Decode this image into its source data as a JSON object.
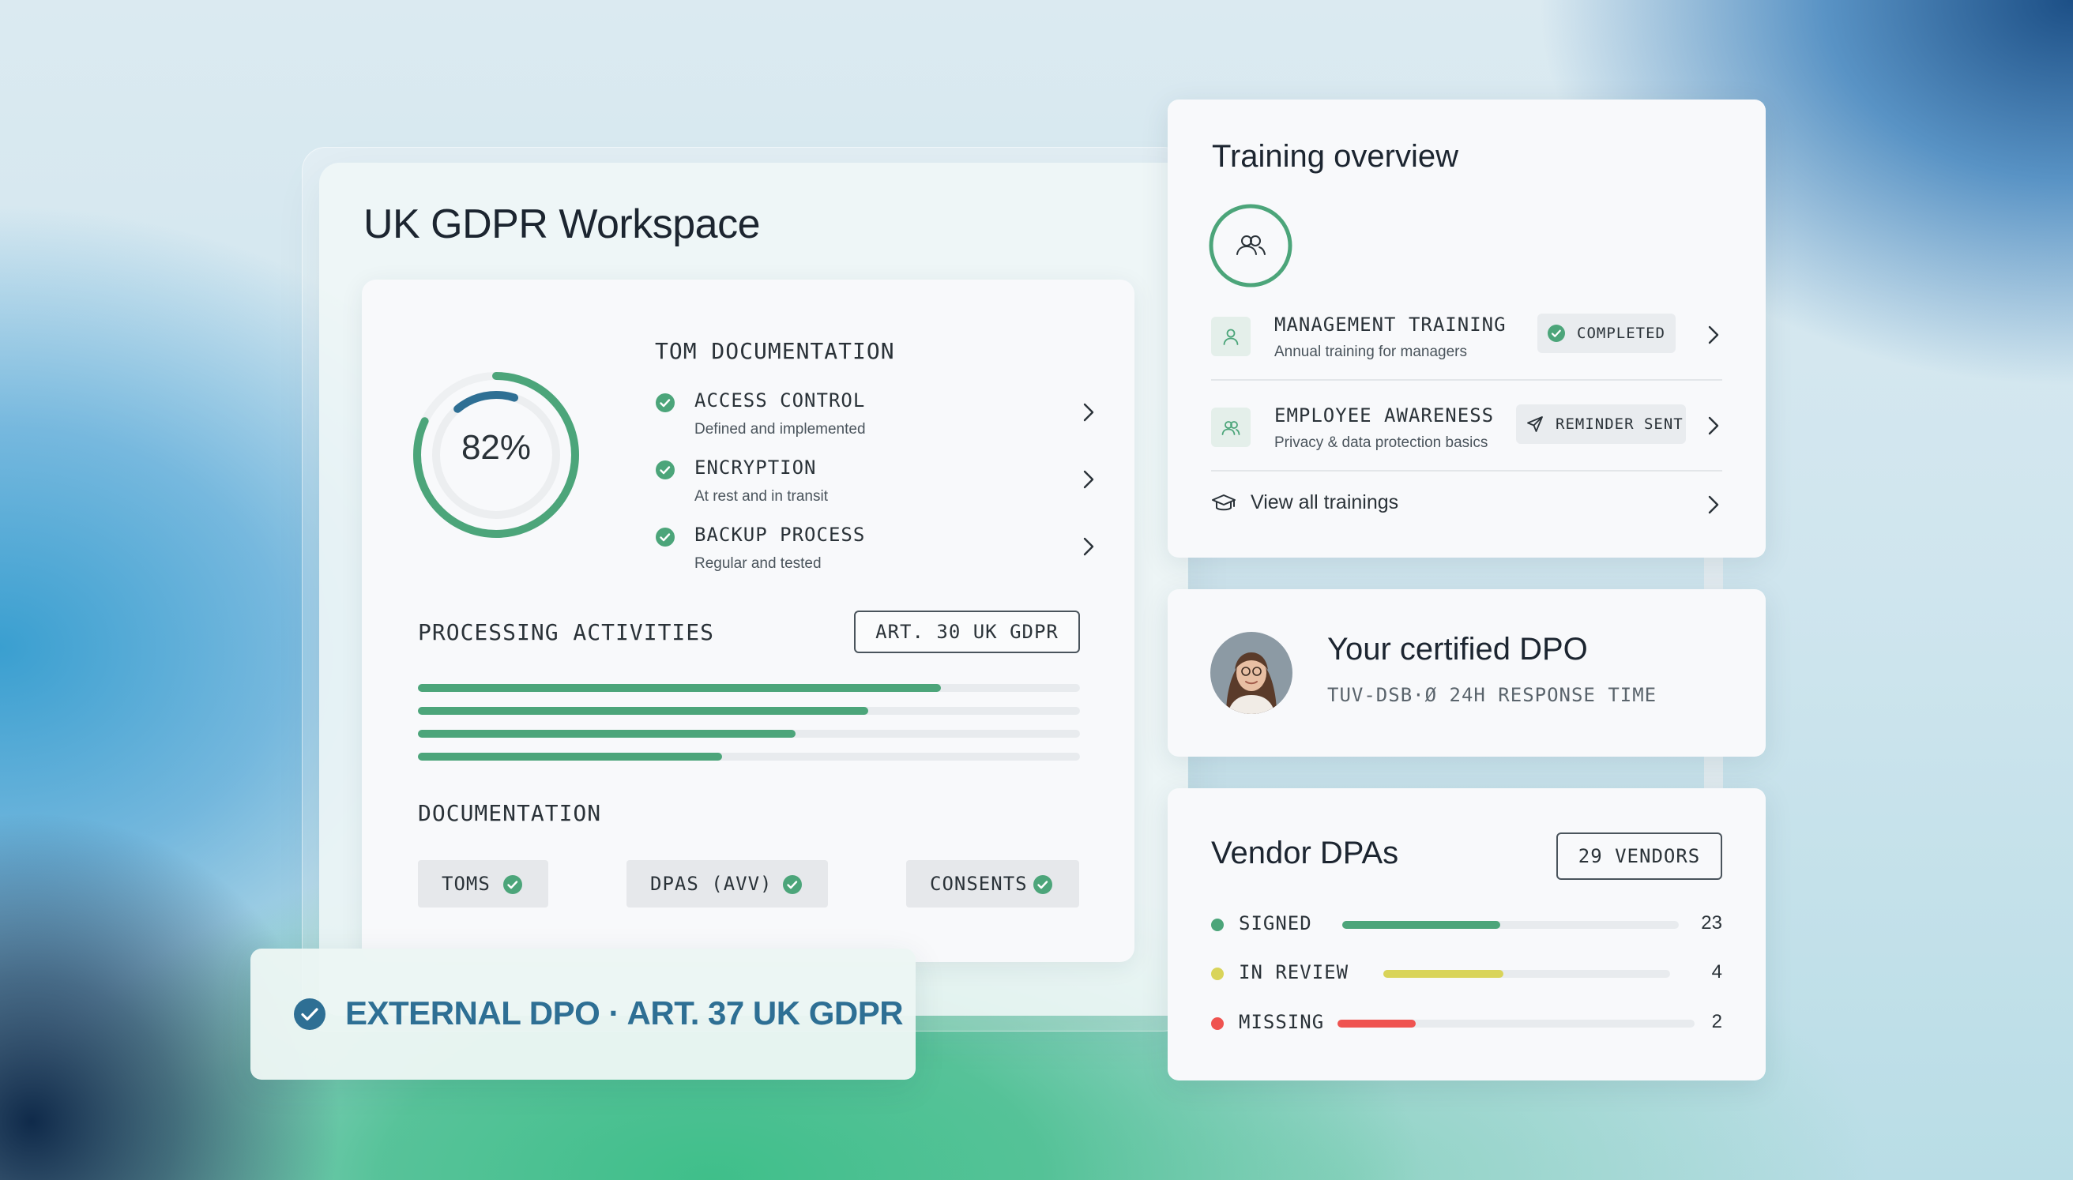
{
  "colors": {
    "accent_green": "#4ca57a",
    "accent_blue": "#2e6f94",
    "review_yellow": "#d9d45a",
    "missing_red": "#ef5350"
  },
  "workspace": {
    "title": "UK GDPR Workspace",
    "score": {
      "label": "82%",
      "outer_fraction": 0.82
    },
    "tom": {
      "heading": "TOM DOCUMENTATION",
      "items": [
        {
          "title": "ACCESS CONTROL",
          "subtitle": "Defined and implemented",
          "icon": "check-circle-icon"
        },
        {
          "title": "ENCRYPTION",
          "subtitle": "At rest and in transit",
          "icon": "check-circle-icon"
        },
        {
          "title": "BACKUP PROCESS",
          "subtitle": "Regular and tested",
          "icon": "check-circle-icon"
        }
      ]
    },
    "processing": {
      "heading": "PROCESSING ACTIVITIES",
      "button": "ART. 30 UK GDPR",
      "progress": [
        0.79,
        0.68,
        0.57,
        0.46
      ]
    },
    "documentation": {
      "heading": "DOCUMENTATION",
      "chips": [
        "TOMS",
        "DPAS (AVV)",
        "CONSENTS"
      ]
    }
  },
  "banner": {
    "text": "EXTERNAL DPO · ART. 37 UK GDPR",
    "icon": "check-circle-icon"
  },
  "training": {
    "title": "Training overview",
    "rows": [
      {
        "title": "MANAGEMENT TRAINING",
        "subtitle": "Annual training for managers",
        "status": "COMPLETED",
        "status_icon": "check-circle-icon",
        "icon": "user-icon"
      },
      {
        "title": "EMPLOYEE AWARENESS",
        "subtitle": "Privacy & data protection basics",
        "status": "REMINDER SENT",
        "status_icon": "send-icon",
        "icon": "users-icon"
      }
    ],
    "view_all": "View all trainings",
    "view_all_icon": "graduation-cap-icon"
  },
  "dpo": {
    "title": "Your certified DPO",
    "subtitle": "TUV-DSB·Ø 24H RESPONSE TIME"
  },
  "vendors": {
    "title": "Vendor DPAs",
    "button": "29 VENDORS",
    "rows": [
      {
        "label": "SIGNED",
        "count": "23",
        "fraction": 0.47,
        "color": "#4ca57a"
      },
      {
        "label": "IN REVIEW",
        "count": "4",
        "fraction": 0.42,
        "color": "#d9d45a"
      },
      {
        "label": "MISSING",
        "count": "2",
        "fraction": 0.22,
        "color": "#ef5350"
      }
    ]
  }
}
